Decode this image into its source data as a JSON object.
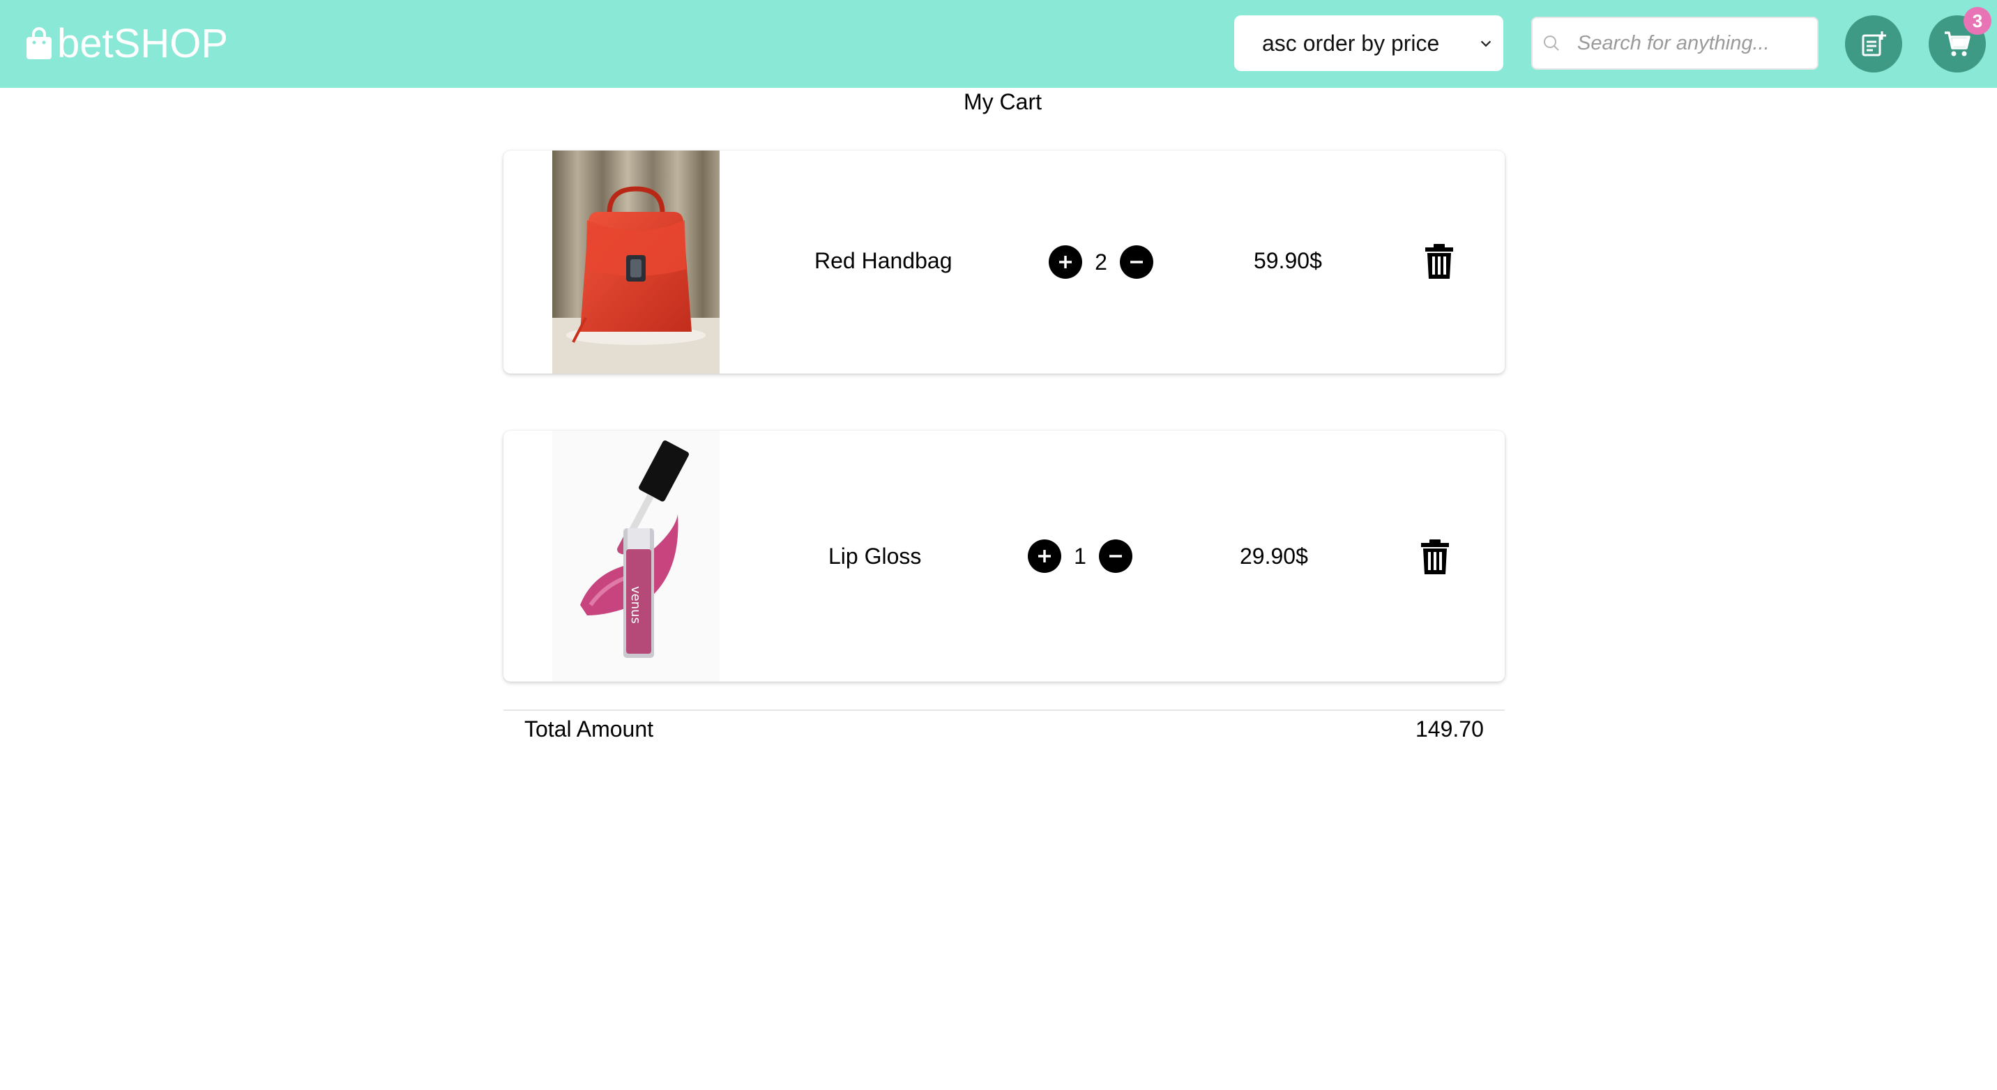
{
  "header": {
    "brand": "betSHOP",
    "sort_value": "asc order by price",
    "search_placeholder": "Search for anything...",
    "cart_count": "3",
    "colors": {
      "bar": "#8ae8d6",
      "button": "#3e9a84",
      "badge": "#e873b5"
    }
  },
  "cart": {
    "title": "My Cart",
    "items": [
      {
        "name": "Red Handbag",
        "quantity": "2",
        "price": "59.90$",
        "image_icon": "red-handbag-image"
      },
      {
        "name": "Lip Gloss",
        "quantity": "1",
        "price": "29.90$",
        "image_icon": "lip-gloss-image"
      }
    ],
    "total_label": "Total Amount",
    "total_value": "149.70"
  }
}
